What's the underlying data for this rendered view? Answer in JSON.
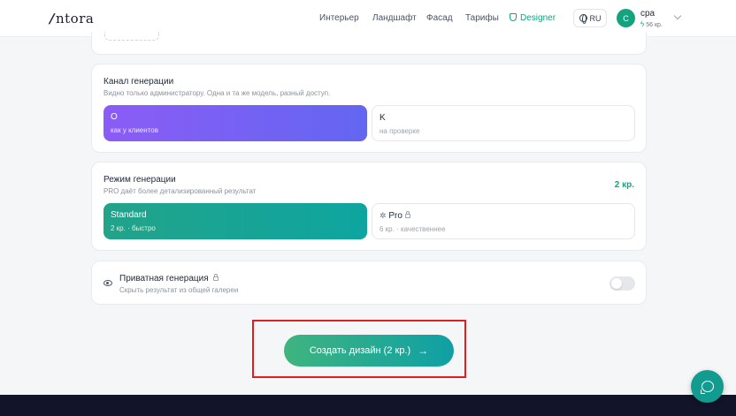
{
  "header": {
    "logo": "ntora",
    "nav": [
      "Интерьер",
      "Ландшафт",
      "Фасад",
      "Тарифы"
    ],
    "designer_label": "Designer",
    "lang": "RU",
    "avatar_letter": "C",
    "username": "cpa",
    "credits": "56 кр."
  },
  "channel": {
    "title": "Канал генерации",
    "subtitle": "Видно только администратору. Одна и та же модель, разный доступ.",
    "options": [
      {
        "title": "O",
        "sub": "как у клиентов"
      },
      {
        "title": "K",
        "sub": "на проверке"
      }
    ]
  },
  "mode": {
    "title": "Режим генерации",
    "subtitle": "PRO даёт более детализированный результат",
    "price": "2 кр.",
    "options": [
      {
        "title": "Standard",
        "sub": "2 кр. · быстро"
      },
      {
        "title": "Pro",
        "sub": "6 кр. · качественнее"
      }
    ]
  },
  "private": {
    "title": "Приватная генерация",
    "subtitle": "Скрыть результат из общей галереи",
    "enabled": false
  },
  "cta": {
    "label": "Создать дизайн (2 кр.)"
  },
  "colors": {
    "accent": "#14a37f",
    "purple": "#7c5cf3",
    "highlight": "#e11d1d"
  }
}
